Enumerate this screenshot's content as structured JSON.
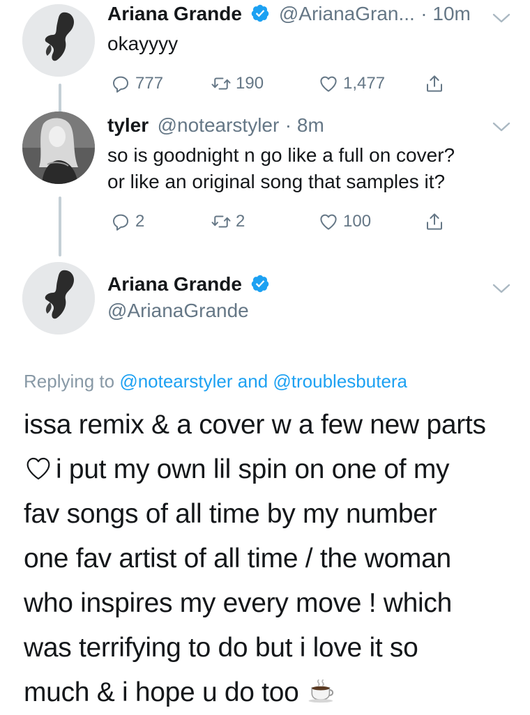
{
  "tweets": [
    {
      "name": "Ariana Grande",
      "handle": "@ArianaGran...",
      "time": "· 10m",
      "text_lines": [
        "okayyyy"
      ],
      "replies": "777",
      "retweets": "190",
      "likes": "1,477"
    },
    {
      "name": "tyler",
      "handle": "@notearstyler",
      "time": "· 8m",
      "text_lines": [
        "so is goodnight n go like a full on cover?",
        "or like an original song that samples it?"
      ],
      "replies": "2",
      "retweets": "2",
      "likes": "100"
    }
  ],
  "main_tweet": {
    "name": "Ariana Grande",
    "handle": "@ArianaGrande",
    "replying_prefix": "Replying to",
    "replying_mention_1": "@notearstyler",
    "replying_and": "and",
    "replying_mention_2": "@troublesbutera",
    "lines": [
      "issa remix & a cover w a few new parts",
      "i put my own lil spin on one of my",
      "fav songs of all time by my number",
      "one fav artist of all time / the woman",
      "who inspires my every move ! which",
      "was terrifying to do but i love it so",
      "much & i hope u do too"
    ]
  },
  "icons": {
    "reply": "reply-icon",
    "retweet": "retweet-icon",
    "like": "heart-icon",
    "share": "share-icon",
    "verified": "verified-badge-icon",
    "caret": "chevron-down-icon",
    "emoji_heart": "white-heart-emoji-icon",
    "emoji_coffee": "hot-beverage-emoji-icon"
  },
  "colors": {
    "verified": "#1da1f2",
    "secondary_text": "#657786",
    "mention": "#1da1f2",
    "thread_line": "#c4cfd6"
  }
}
